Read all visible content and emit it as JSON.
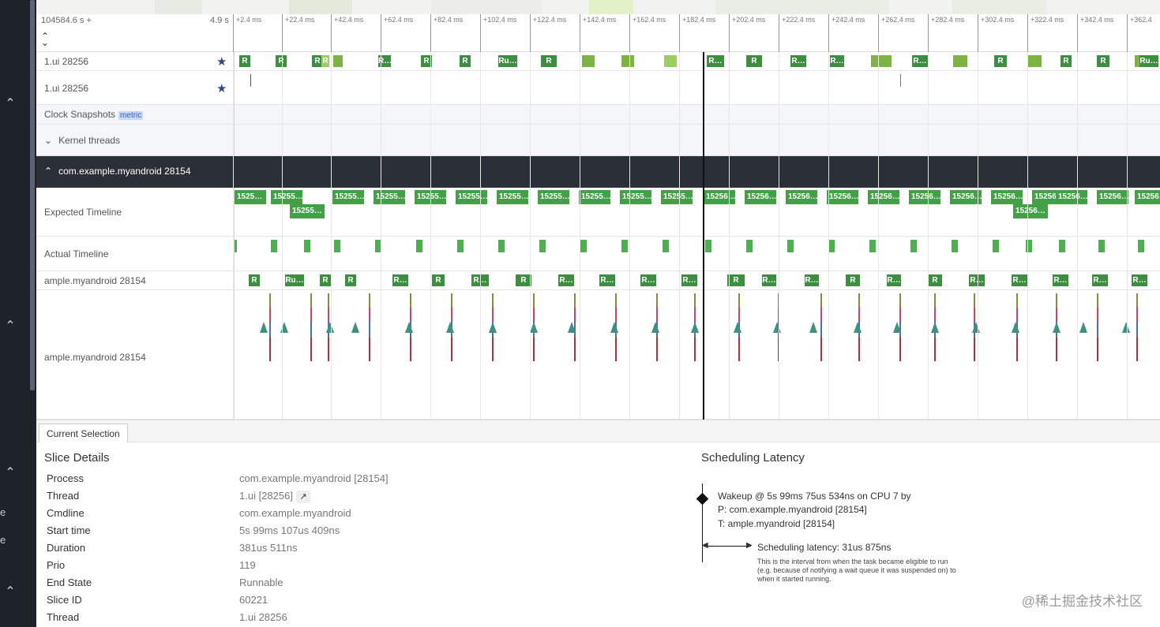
{
  "ruler": {
    "start": "104584.6 s +",
    "span": "4.9 s",
    "ticks": [
      "+2.4 ms",
      "+22.4 ms",
      "+42.4 ms",
      "+62.4 ms",
      "+82.4 ms",
      "+102.4 ms",
      "+122.4 ms",
      "+142.4 ms",
      "+162.4 ms",
      "+182.4 ms",
      "+202.4 ms",
      "+222.4 ms",
      "+242.4 ms",
      "+262.4 ms",
      "+282.4 ms",
      "+302.4 ms",
      "+322.4 ms",
      "+342.4 ms",
      "+362.4"
    ]
  },
  "tracks": {
    "ui_thread_1": "1.ui 28256",
    "ui_thread_2": "1.ui 28256",
    "clock_snapshots": "Clock Snapshots",
    "metric_badge": "metric",
    "kernel_threads": "Kernel threads",
    "process_group": "com.example.myandroid 28154",
    "expected_timeline": "Expected Timeline",
    "actual_timeline": "Actual Timeline",
    "main_thread_slices": "ample.myandroid 28154",
    "main_thread_sched": "ample.myandroid 28154"
  },
  "slice_labels": {
    "r": "R",
    "ru": "Ru…",
    "r_trunc": "R…",
    "frame_short": "1525…",
    "frame_a": "15255…",
    "frame_b": "15256…"
  },
  "panel": {
    "tab": "Current Selection",
    "details_title": "Slice Details",
    "details": [
      {
        "key": "Process",
        "value": "com.example.myandroid [28154]"
      },
      {
        "key": "Thread",
        "value": "1.ui [28256]"
      },
      {
        "key": "Cmdline",
        "value": "com.example.myandroid"
      },
      {
        "key": "Start time",
        "value": "5s 99ms 107us 409ns"
      },
      {
        "key": "Duration",
        "value": "381us 511ns"
      },
      {
        "key": "Prio",
        "value": "119"
      },
      {
        "key": "End State",
        "value": "Runnable"
      },
      {
        "key": "Slice ID",
        "value": "60221"
      },
      {
        "key": "Thread",
        "value": "1.ui 28256"
      }
    ],
    "latency_title": "Scheduling Latency",
    "wakeup": "Wakeup @ 5s 99ms 75us 534ns on CPU 7 by",
    "wakeup_process": "P: com.example.myandroid [28154]",
    "wakeup_thread": "T: ample.myandroid [28154]",
    "latency_value": "Scheduling latency: 31us 875ns",
    "latency_desc_1": "This is the interval from when the task became eligible to run",
    "latency_desc_2": "(e.g. because of notifying a wait queue it was suspended on) to",
    "latency_desc_3": "when it started running."
  },
  "sidebar": {
    "cut_text_1": "e",
    "cut_text_2": "e"
  },
  "watermark": "@稀土掘金技术社区",
  "colors": {
    "slice_green": "#3e8e41",
    "frame_green": "#43a047",
    "cursor": "#111111",
    "sidebar": "#1e2329",
    "group_header": "#2b2f36"
  }
}
